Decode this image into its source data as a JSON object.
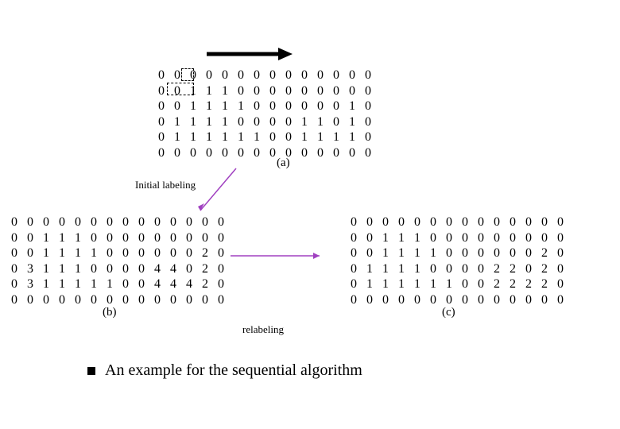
{
  "matrices": {
    "a": [
      [
        0,
        0,
        0,
        0,
        0,
        0,
        0,
        0,
        0,
        0,
        0,
        0,
        0,
        0
      ],
      [
        0,
        0,
        1,
        1,
        1,
        0,
        0,
        0,
        0,
        0,
        0,
        0,
        0,
        0
      ],
      [
        0,
        0,
        1,
        1,
        1,
        1,
        0,
        0,
        0,
        0,
        0,
        0,
        1,
        0
      ],
      [
        0,
        1,
        1,
        1,
        1,
        0,
        0,
        0,
        0,
        1,
        1,
        0,
        1,
        0
      ],
      [
        0,
        1,
        1,
        1,
        1,
        1,
        1,
        0,
        0,
        1,
        1,
        1,
        1,
        0
      ],
      [
        0,
        0,
        0,
        0,
        0,
        0,
        0,
        0,
        0,
        0,
        0,
        0,
        0,
        0
      ]
    ],
    "b": [
      [
        0,
        0,
        0,
        0,
        0,
        0,
        0,
        0,
        0,
        0,
        0,
        0,
        0,
        0
      ],
      [
        0,
        0,
        1,
        1,
        1,
        0,
        0,
        0,
        0,
        0,
        0,
        0,
        0,
        0
      ],
      [
        0,
        0,
        1,
        1,
        1,
        1,
        0,
        0,
        0,
        0,
        0,
        0,
        2,
        0
      ],
      [
        0,
        3,
        1,
        1,
        1,
        0,
        0,
        0,
        0,
        4,
        4,
        0,
        2,
        0
      ],
      [
        0,
        3,
        1,
        1,
        1,
        1,
        1,
        0,
        0,
        4,
        4,
        4,
        2,
        0
      ],
      [
        0,
        0,
        0,
        0,
        0,
        0,
        0,
        0,
        0,
        0,
        0,
        0,
        0,
        0
      ]
    ],
    "c": [
      [
        0,
        0,
        0,
        0,
        0,
        0,
        0,
        0,
        0,
        0,
        0,
        0,
        0,
        0
      ],
      [
        0,
        0,
        1,
        1,
        1,
        0,
        0,
        0,
        0,
        0,
        0,
        0,
        0,
        0
      ],
      [
        0,
        0,
        1,
        1,
        1,
        1,
        0,
        0,
        0,
        0,
        0,
        0,
        2,
        0
      ],
      [
        0,
        1,
        1,
        1,
        1,
        0,
        0,
        0,
        0,
        2,
        2,
        0,
        2,
        0
      ],
      [
        0,
        1,
        1,
        1,
        1,
        1,
        1,
        0,
        0,
        2,
        2,
        2,
        2,
        0
      ],
      [
        0,
        0,
        0,
        0,
        0,
        0,
        0,
        0,
        0,
        0,
        0,
        0,
        0,
        0
      ]
    ]
  },
  "labels": {
    "a": "(a)",
    "b": "(b)",
    "c": "(c)",
    "initial_labeling": "Initial labeling",
    "relabeling": "relabeling",
    "caption": "An example for the sequential algorithm"
  }
}
